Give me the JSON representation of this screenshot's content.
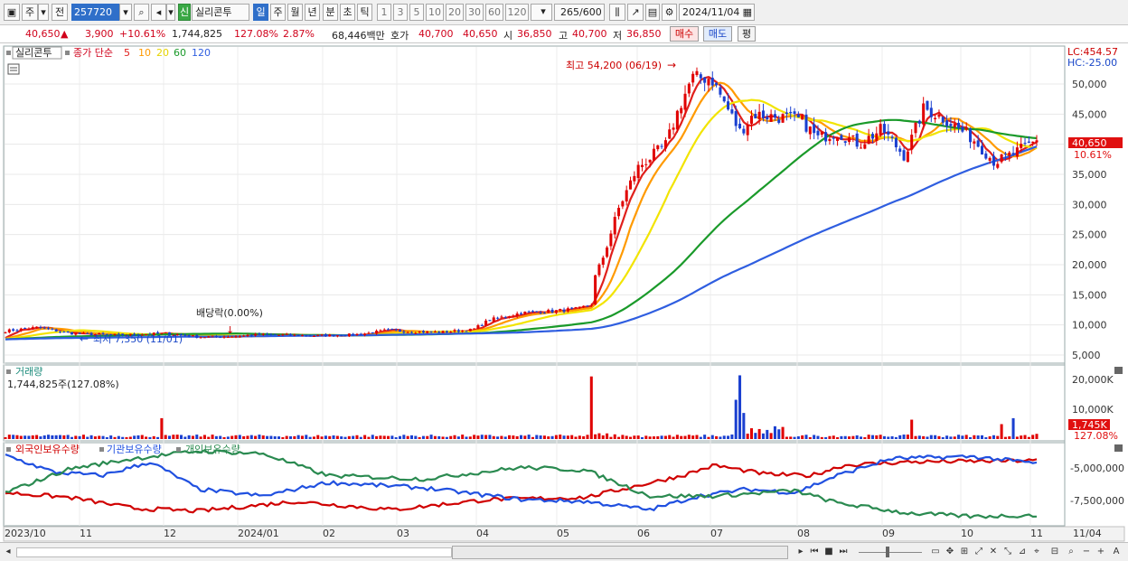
{
  "toolbar": {
    "mode_label": "주",
    "prev_label": "전",
    "code_value": "257720",
    "new_badge": "신",
    "stock_name": "실리콘투",
    "periods": [
      "일",
      "주",
      "월",
      "년",
      "분",
      "초",
      "틱"
    ],
    "active_period": "일",
    "intervals": [
      "1",
      "3",
      "5",
      "10",
      "20",
      "30",
      "60",
      "120"
    ],
    "count_value": "265",
    "count_total": "/600",
    "date_value": "2024/11/04"
  },
  "quote": {
    "price": "40,650",
    "arrow": "▲",
    "change": "3,900",
    "change_pct": "+10.61%",
    "volume": "1,744,825",
    "volume_ratio": "127.08%",
    "turnover_rate": "2.87%",
    "amount": "68,446백만",
    "bid_label": "호가",
    "bid": "40,700",
    "ask": "40,650",
    "open_label": "시",
    "open": "36,850",
    "high_label": "고",
    "high": "40,700",
    "low_label": "저",
    "low": "36,850",
    "buy_label": "매수",
    "sell_label": "매도",
    "eval_label": "평"
  },
  "price_panel": {
    "title": "실리콘투",
    "legend_prefix": "종가 단순",
    "ma_periods": [
      "5",
      "10",
      "20",
      "60",
      "120"
    ],
    "ma_colors": [
      "#e0201c",
      "#ff9a00",
      "#f2e400",
      "#1a9a2a",
      "#2f5ee0"
    ],
    "lc": "LC:454.57",
    "hc": "HC:-25.00",
    "high_note": "최고 54,200 (06/19)",
    "low_note": "최저 7,350 (11/01)",
    "dividend_note": "배당락(0.00%)",
    "last_price_label": "40,650",
    "last_pct_label": "10.61%",
    "y_ticks": [
      "50,000",
      "45,000",
      "40,000",
      "35,000",
      "30,000",
      "25,000",
      "20,000",
      "15,000",
      "10,000",
      "5,000"
    ]
  },
  "volume_panel": {
    "title": "거래량",
    "value": "1,744,825주(127.08%)",
    "y_ticks": [
      "20,000K",
      "10,000K"
    ],
    "last_label": "1,745K",
    "last_pct": "127.08%"
  },
  "holdings_panel": {
    "legend": [
      "외국인보유수량",
      "기관보유수량",
      "개인보유수량"
    ],
    "colors": [
      "#d00000",
      "#2050e0",
      "#2a8a50"
    ],
    "y_ticks": [
      "-5,000,000",
      "-7,500,000"
    ]
  },
  "x_axis": {
    "labels": [
      "2023/10",
      "11",
      "12",
      "2024/01",
      "02",
      "03",
      "04",
      "05",
      "06",
      "07",
      "08",
      "09",
      "10",
      "11"
    ],
    "last_label": "11/04"
  },
  "colors": {
    "up": "#d0021b",
    "down": "#1a47c8",
    "grid": "#e6e6e6"
  }
}
